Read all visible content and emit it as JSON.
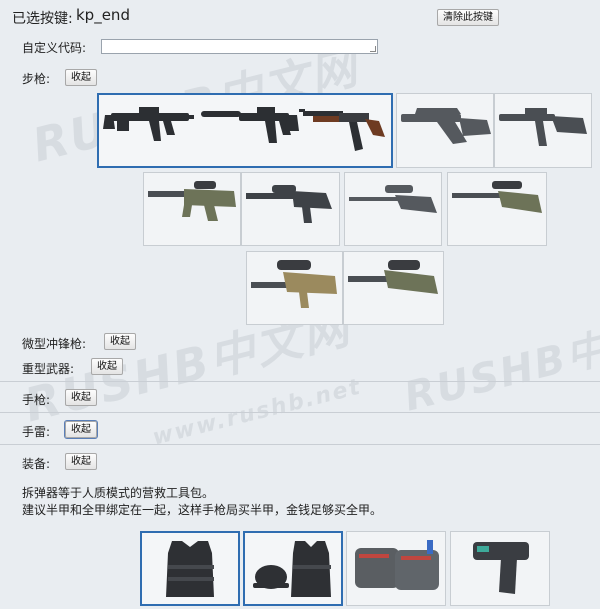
{
  "header": {
    "selected_key_label": "已选按键:",
    "selected_key_value": "kp_end",
    "clear_button": "清除此按键"
  },
  "custom_code": {
    "label": "自定义代码:",
    "value": ""
  },
  "watermark": {
    "logo": "RUSHB中文网",
    "url": "www.rushb.net"
  },
  "sections": {
    "rifles": {
      "label": "步枪:",
      "collapse": "收起"
    },
    "smg": {
      "label": "微型冲锋枪:",
      "collapse": "收起"
    },
    "heavy": {
      "label": "重型武器:",
      "collapse": "收起"
    },
    "pistols": {
      "label": "手枪:",
      "collapse": "收起"
    },
    "grenades": {
      "label": "手雷:",
      "collapse": "收起"
    },
    "equipment": {
      "label": "装备:",
      "collapse": "收起",
      "desc_line1": "拆弹器等于人质模式的营救工具包。",
      "desc_line2": "建议半甲和全甲绑定在一起，这样手枪局买半甲，金钱足够买全甲。"
    }
  },
  "rifle_cards": [
    {
      "icons": [
        "m4a4-icon",
        "m4a1s-icon",
        "ak47-icon"
      ],
      "selected": true
    },
    {
      "icons": [
        "famas-icon"
      ],
      "selected": false
    },
    {
      "icons": [
        "galil-icon"
      ],
      "selected": false
    },
    {
      "icons": [
        "aug-icon"
      ],
      "selected": false
    },
    {
      "icons": [
        "sg553-icon"
      ],
      "selected": false
    },
    {
      "icons": [
        "ssg08-icon"
      ],
      "selected": false
    },
    {
      "icons": [
        "awp-icon"
      ],
      "selected": false
    },
    {
      "icons": [
        "scar20-icon"
      ],
      "selected": false
    },
    {
      "icons": [
        "g3sg1-icon"
      ],
      "selected": false
    }
  ],
  "equipment_cards": [
    {
      "icons": [
        "kevlar-vest-icon"
      ],
      "selected": true
    },
    {
      "icons": [
        "kevlar-helmet-icon"
      ],
      "selected": true
    },
    {
      "icons": [
        "defuse-kit-icon"
      ],
      "selected": false
    },
    {
      "icons": [
        "zeus-taser-icon"
      ],
      "selected": false
    }
  ],
  "colors": {
    "background": "#e9edf1",
    "selected_border": "#2f6db1",
    "card_bg": "#f2f4f6",
    "gun_dark": "#2c2f33",
    "gun_wood": "#6e3b22",
    "gun_olive": "#6d7358",
    "gun_tan": "#9b8a5e"
  }
}
